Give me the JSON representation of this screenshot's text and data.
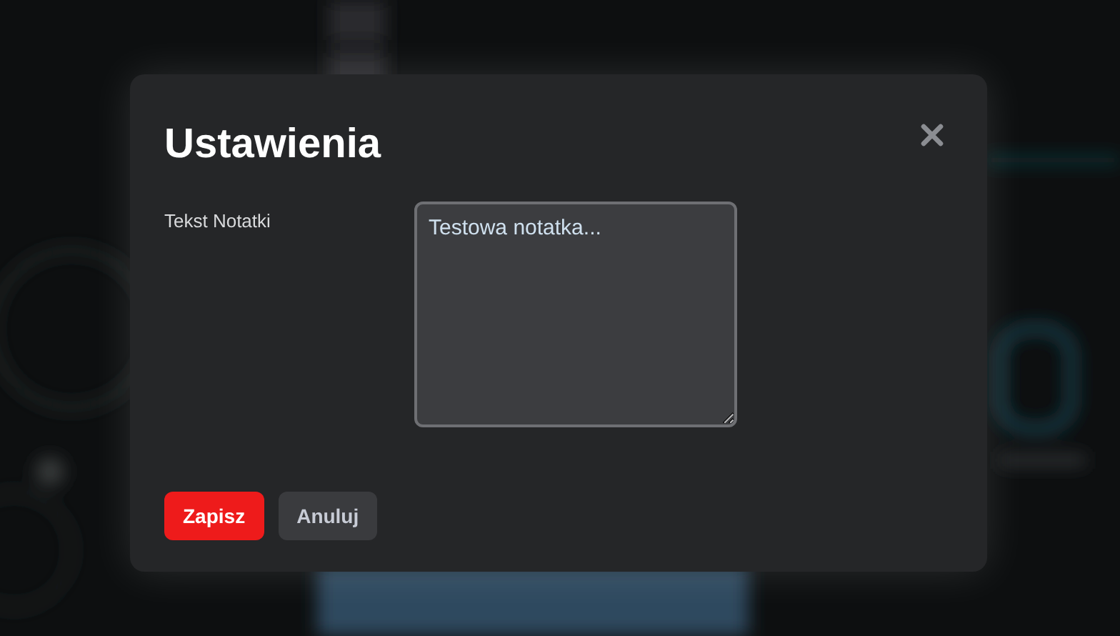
{
  "dialog": {
    "title": "Ustawienia",
    "fields": [
      {
        "label": "Tekst Notatki",
        "value": "Testowa notatka..."
      }
    ],
    "buttons": [
      {
        "label": "Zapisz",
        "kind": "primary"
      },
      {
        "label": "Anuluj",
        "kind": "secondary"
      }
    ]
  }
}
